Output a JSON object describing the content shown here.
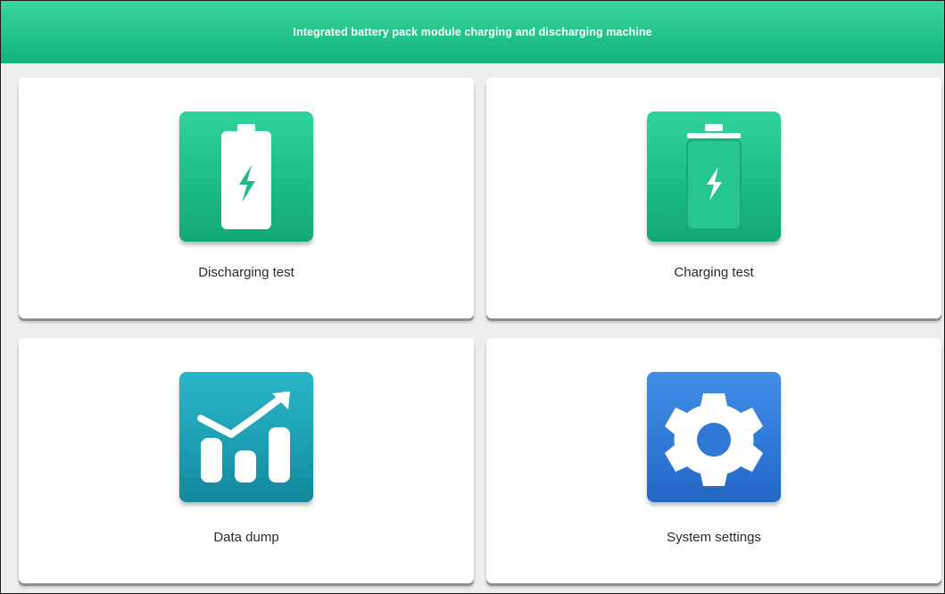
{
  "header": {
    "title": "Integrated battery pack module charging and discharging machine"
  },
  "tiles": [
    {
      "label": "Discharging test",
      "icon": "battery-discharge-icon"
    },
    {
      "label": "Charging test",
      "icon": "battery-charge-icon"
    },
    {
      "label": "Data dump",
      "icon": "chart-trend-icon"
    },
    {
      "label": "System settings",
      "icon": "gear-icon"
    }
  ],
  "colors": {
    "header": "#22c48a",
    "discharging_icon": "#1bbb86",
    "charging_icon": "#1bbb86",
    "data_dump_icon": "#1c9db1",
    "settings_icon": "#2f78d6",
    "background": "#eeeeee"
  }
}
